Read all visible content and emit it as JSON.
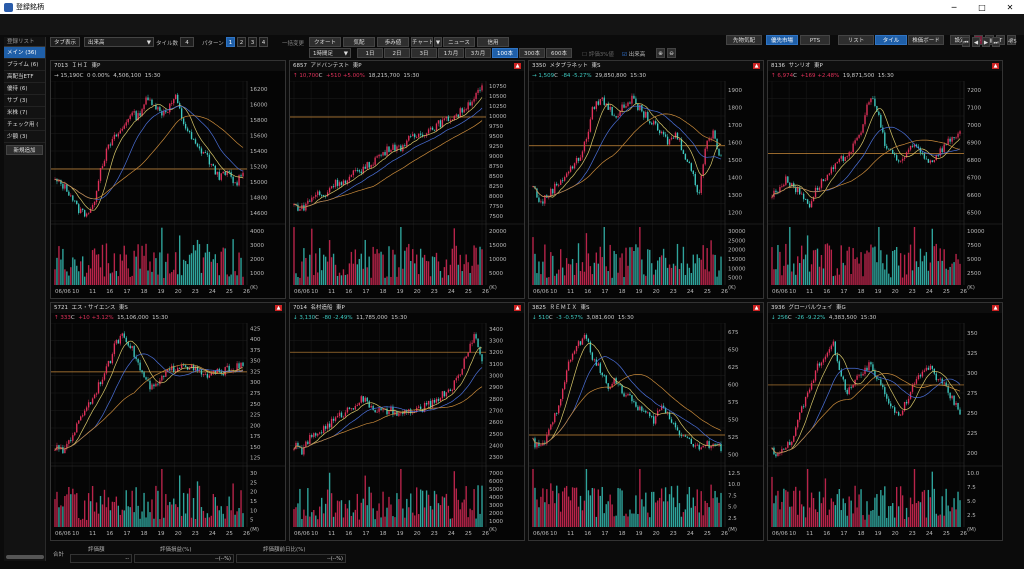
{
  "window": {
    "title": "登録銘柄",
    "min": "─",
    "max": "□",
    "close": "✕"
  },
  "topbar": {
    "row1": {
      "tab_display": "タブ表示",
      "market_select": "出来高",
      "tile_count_label": "タイル数",
      "tile_count": "4",
      "pattern_label": "パターン",
      "patterns": [
        "1",
        "2",
        "3",
        "4"
      ],
      "bulk_change": "一括変更",
      "quote": "クオート",
      "ita": "気配",
      "ayumi": "歩み値",
      "chart": "チャート",
      "news": "ニュース",
      "credit": "信用",
      "right_btns": [
        "先物気配",
        "優先市場",
        "PTS"
      ],
      "view_btns": [
        "リスト",
        "タイル",
        "株価ボード"
      ],
      "settings": "設定",
      "icons": [
        "link-icon",
        "tile-layout-icon",
        "text-icon",
        "help-icon"
      ]
    },
    "row2": {
      "interval": "1時間足",
      "periods": [
        "1日",
        "2日",
        "3日",
        "1カ月",
        "3カ月",
        "100本",
        "300本",
        "600本"
      ],
      "active_period": "100本",
      "ma_check": "評価3%値",
      "volume_check": "出来高",
      "page": "4/5",
      "nav": [
        "⏮",
        "◀",
        "▶",
        "⏭"
      ]
    }
  },
  "sidebar": {
    "title": "登録リスト",
    "items": [
      {
        "label": "メイン (36)",
        "active": true
      },
      {
        "label": "プライム (6)",
        "active": false
      },
      {
        "label": "高配当ETF",
        "active": false
      },
      {
        "label": "優待 (6)",
        "active": false
      },
      {
        "label": "サブ (3)",
        "active": false
      },
      {
        "label": "米株 (7)",
        "active": false
      },
      {
        "label": "チェック用 (",
        "active": false
      },
      {
        "label": "少額 (3)",
        "active": false
      }
    ],
    "add_button": "新規追加"
  },
  "footer": {
    "total": "合計",
    "eval_amount": "評価額",
    "eval_pl": "評価損益(%)",
    "prev_diff": "評価額前日比(%)",
    "eval_amount_val": "--",
    "eval_pl_val": "--(--%)",
    "prev_diff_val": "--(--%)"
  },
  "tiles": [
    {
      "code": "7013",
      "name": "ＩＨＩ",
      "market": "東P",
      "arrow": "→",
      "price": "15,190",
      "unit": "C",
      "change": "0",
      "pct": "0.00%",
      "dir": "fl",
      "volume": "4,506,100",
      "time": "15:30",
      "alert": false,
      "price_ticks": [
        "16200",
        "16000",
        "15800",
        "15600",
        "15400",
        "15200",
        "15000",
        "14800",
        "14600"
      ],
      "vol_ticks": [
        "4000",
        "3000",
        "2000",
        "1000",
        "(K)"
      ],
      "ref_line": 15200,
      "range": [
        14550,
        16300
      ],
      "series": [
        15050,
        15000,
        14900,
        14700,
        14650,
        14700,
        15200,
        15450,
        15600,
        15700,
        15900,
        15850,
        16050,
        16050,
        15900,
        15950,
        16100,
        15800,
        15600,
        15450,
        15400,
        15200,
        15100,
        15150,
        15000,
        15200
      ]
    },
    {
      "code": "6857",
      "name": "アドバンテスト",
      "market": "東P",
      "arrow": "↑",
      "price": "10,700",
      "unit": "C",
      "change": "+510",
      "pct": "+5.00%",
      "dir": "up",
      "volume": "18,215,700",
      "time": "15:30",
      "alert": true,
      "price_ticks": [
        "10750",
        "10500",
        "10250",
        "10000",
        "9750",
        "9500",
        "9250",
        "9000",
        "8750",
        "8500",
        "8250",
        "8000",
        "7750",
        "7500"
      ],
      "vol_ticks": [
        "20000",
        "15000",
        "10000",
        "5000",
        "(K)"
      ],
      "ref_line": 10000,
      "range": [
        7400,
        10900
      ],
      "series": [
        7800,
        7700,
        7900,
        8100,
        8000,
        8300,
        8400,
        8350,
        8600,
        8700,
        8800,
        9000,
        9100,
        9300,
        9200,
        9400,
        9500,
        9600,
        9700,
        9800,
        9900,
        10000,
        10100,
        10300,
        10500,
        10700
      ]
    },
    {
      "code": "3350",
      "name": "メタプラネット",
      "market": "東S",
      "arrow": "→",
      "price": "1,509",
      "unit": "C",
      "change": "-84",
      "pct": "-5.27%",
      "dir": "dn",
      "volume": "29,850,800",
      "time": "15:30",
      "alert": true,
      "price_ticks": [
        "1900",
        "1800",
        "1700",
        "1600",
        "1500",
        "1400",
        "1300",
        "1200"
      ],
      "vol_ticks": [
        "30000",
        "25000",
        "20000",
        "15000",
        "10000",
        "5000",
        "(K)"
      ],
      "ref_line": 1580,
      "range": [
        1150,
        1950
      ],
      "series": [
        1350,
        1250,
        1300,
        1350,
        1400,
        1450,
        1500,
        1600,
        1800,
        1850,
        1800,
        1750,
        1800,
        1850,
        1800,
        1750,
        1700,
        1650,
        1600,
        1650,
        1550,
        1450,
        1300,
        1600,
        1650,
        1509
      ]
    },
    {
      "code": "8136",
      "name": "サンリオ",
      "market": "東P",
      "arrow": "↑",
      "price": "6,974",
      "unit": "C",
      "change": "+169",
      "pct": "+2.48%",
      "dir": "up",
      "volume": "19,871,500",
      "time": "15:30",
      "alert": true,
      "price_ticks": [
        "7200",
        "7100",
        "7000",
        "6900",
        "6800",
        "6700",
        "6600",
        "6500"
      ],
      "vol_ticks": [
        "10000",
        "7500",
        "5000",
        "2500",
        "(K)"
      ],
      "ref_line": 6850,
      "range": [
        6450,
        7280
      ],
      "series": [
        6600,
        6650,
        6700,
        6650,
        6600,
        6550,
        6650,
        6700,
        6750,
        6800,
        6850,
        6900,
        7000,
        7200,
        7100,
        6900,
        6850,
        6800,
        6850,
        6900,
        6850,
        6800,
        6850,
        6900,
        6950,
        6974
      ]
    },
    {
      "code": "5721",
      "name": "エス・サイエンス",
      "market": "東S",
      "arrow": "↑",
      "price": "333",
      "unit": "C",
      "change": "+10",
      "pct": "+3.12%",
      "dir": "up",
      "volume": "15,106,000",
      "time": "15:30",
      "alert": true,
      "price_ticks": [
        "425",
        "400",
        "375",
        "350",
        "325",
        "300",
        "275",
        "250",
        "225",
        "200",
        "175",
        "150",
        "125"
      ],
      "vol_ticks": [
        "30",
        "25",
        "20",
        "15",
        "10",
        "5",
        "(M)"
      ],
      "ref_line": 320,
      "range": [
        115,
        430
      ],
      "series": [
        150,
        140,
        170,
        200,
        240,
        260,
        300,
        330,
        380,
        410,
        380,
        340,
        300,
        280,
        300,
        320,
        330,
        340,
        330,
        320,
        310,
        315,
        320,
        325,
        330,
        333
      ]
    },
    {
      "code": "7014",
      "name": "名村造船",
      "market": "東P",
      "arrow": "↓",
      "price": "3,130",
      "unit": "C",
      "change": "-80",
      "pct": "-2.49%",
      "dir": "dn",
      "volume": "11,785,000",
      "time": "15:30",
      "alert": true,
      "price_ticks": [
        "3400",
        "3300",
        "3200",
        "3100",
        "3000",
        "2900",
        "2800",
        "2700",
        "2600",
        "2500",
        "2400",
        "2300"
      ],
      "vol_ticks": [
        "7000",
        "6000",
        "5000",
        "4000",
        "3000",
        "2000",
        "1000",
        "(K)"
      ],
      "ref_line": 3200,
      "range": [
        2250,
        3450
      ],
      "series": [
        2400,
        2350,
        2450,
        2500,
        2550,
        2600,
        2650,
        2700,
        2750,
        2800,
        2750,
        2700,
        2680,
        2700,
        2650,
        2700,
        2680,
        2720,
        2750,
        2800,
        2850,
        2900,
        3000,
        3200,
        3350,
        3130
      ]
    },
    {
      "code": "3825",
      "name": "ＲＥＭＩＸ",
      "market": "東S",
      "arrow": "↓",
      "price": "510",
      "unit": "C",
      "change": "-3",
      "pct": "-0.57%",
      "dir": "dn",
      "volume": "3,081,600",
      "time": "15:30",
      "alert": true,
      "price_ticks": [
        "675",
        "650",
        "625",
        "600",
        "575",
        "550",
        "525",
        "500"
      ],
      "vol_ticks": [
        "12.5",
        "10.0",
        "7.5",
        "5.0",
        "2.5",
        "(M)"
      ],
      "ref_line": 530,
      "range": [
        490,
        690
      ],
      "series": [
        520,
        510,
        530,
        560,
        600,
        640,
        660,
        670,
        640,
        620,
        600,
        610,
        590,
        580,
        570,
        560,
        550,
        570,
        560,
        540,
        530,
        520,
        510,
        515,
        520,
        510
      ]
    },
    {
      "code": "3936",
      "name": "グローバルウェイ",
      "market": "東G",
      "arrow": "↓",
      "price": "256",
      "unit": "C",
      "change": "-26",
      "pct": "-9.22%",
      "dir": "dn",
      "volume": "4,383,500",
      "time": "15:30",
      "alert": true,
      "price_ticks": [
        "350",
        "325",
        "300",
        "275",
        "250",
        "225",
        "200"
      ],
      "vol_ticks": [
        "10.0",
        "7.5",
        "5.0",
        "2.5",
        "(M)"
      ],
      "ref_line": 287,
      "range": [
        195,
        360
      ],
      "series": [
        210,
        205,
        215,
        230,
        260,
        280,
        310,
        320,
        340,
        300,
        280,
        290,
        300,
        310,
        295,
        280,
        260,
        250,
        270,
        290,
        300,
        310,
        295,
        285,
        270,
        256
      ]
    }
  ],
  "x_labels": [
    "06/06",
    "10",
    "11",
    "16",
    "17",
    "18",
    "19",
    "20",
    "23",
    "24",
    "25",
    "26"
  ]
}
